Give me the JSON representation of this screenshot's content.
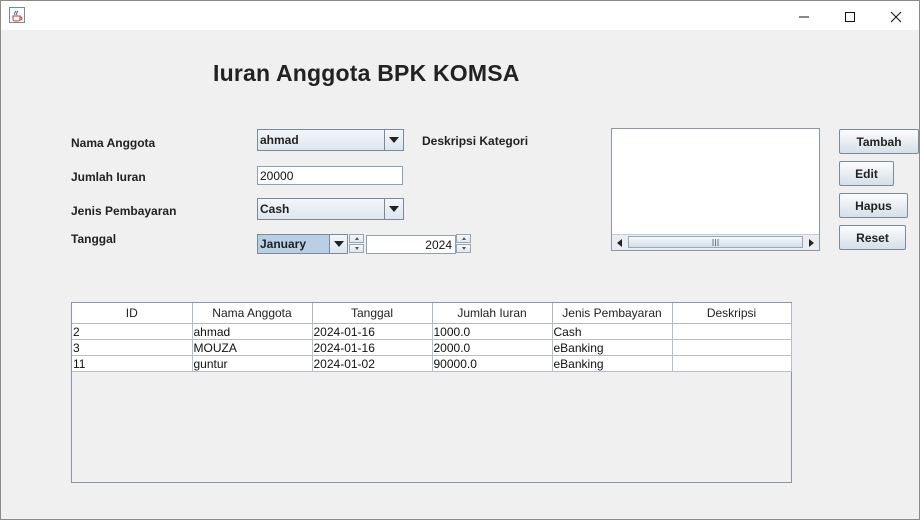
{
  "window": {
    "icon": "java-coffee-icon",
    "controls": [
      "minimize-icon",
      "maximize-icon",
      "close-icon"
    ]
  },
  "title": "Iuran Anggota BPK KOMSA",
  "form": {
    "nama_label": "Nama Anggota",
    "nama_value": "ahmad",
    "jumlah_label": "Jumlah Iuran",
    "jumlah_value": "20000",
    "jenis_label": "Jenis Pembayaran",
    "jenis_value": "Cash",
    "tanggal_label": "Tanggal",
    "month_value": "January",
    "year_value": "2024",
    "deskripsi_label": "Deskripsi Kategori",
    "deskripsi_value": ""
  },
  "buttons": {
    "tambah": "Tambah",
    "edit": "Edit",
    "hapus": "Hapus",
    "reset": "Reset"
  },
  "table": {
    "columns": [
      "ID",
      "Nama Anggota",
      "Tanggal",
      "Jumlah Iuran",
      "Jenis Pembayaran",
      "Deskripsi"
    ],
    "rows": [
      [
        "2",
        "ahmad",
        "2024-01-16",
        "1000.0",
        "Cash",
        ""
      ],
      [
        "3",
        "MOUZA",
        "2024-01-16",
        "2000.0",
        "eBanking",
        ""
      ],
      [
        "11",
        "guntur",
        "2024-01-02",
        "90000.0",
        "eBanking",
        ""
      ]
    ]
  },
  "colors": {
    "window_bg": "#f0f0f0",
    "month_highlight": "#b8cfe5"
  }
}
